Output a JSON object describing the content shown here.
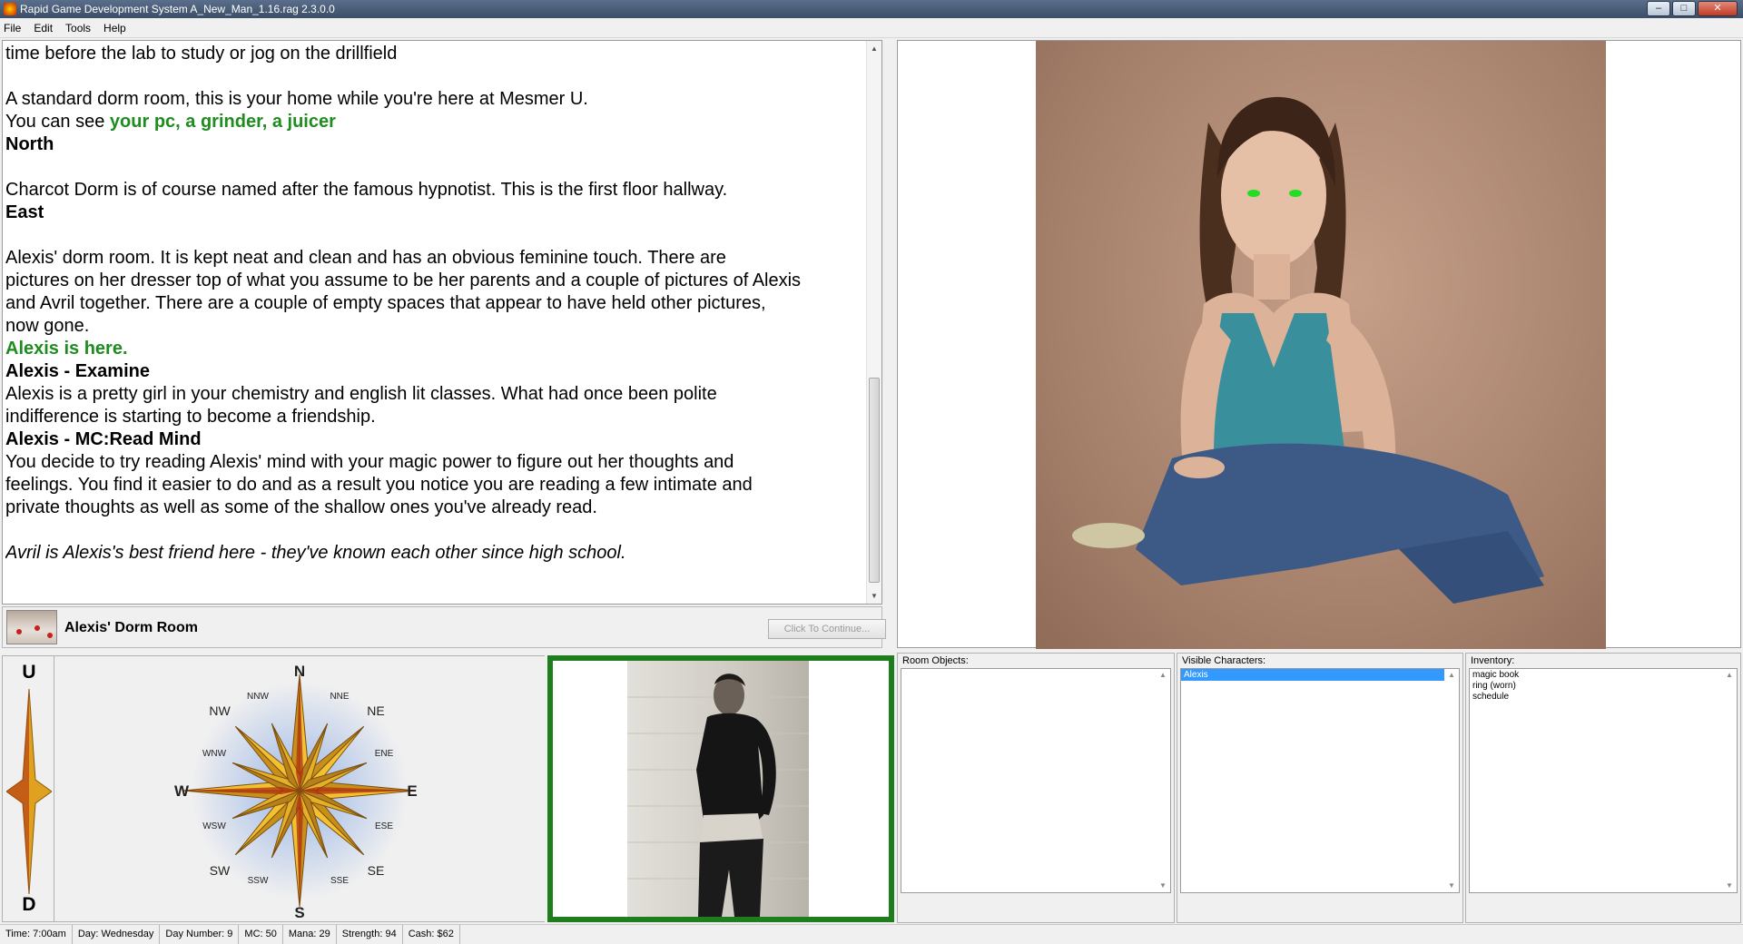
{
  "window": {
    "title": "Rapid Game Development System A_New_Man_1.16.rag 2.3.0.0"
  },
  "menu": [
    "File",
    "Edit",
    "Tools",
    "Help"
  ],
  "story": {
    "lines": [
      {
        "text": "time before the lab to study or jog on the drillfield",
        "style": ""
      },
      {
        "text": "",
        "style": ""
      },
      {
        "text": "A standard dorm room, this is your home while you're here at Mesmer U.",
        "style": ""
      },
      {
        "text": "",
        "style": "see"
      },
      {
        "text": "North",
        "style": "b"
      },
      {
        "text": "",
        "style": ""
      },
      {
        "text": "Charcot Dorm is of course named after the famous hypnotist.   This is the first floor hallway.",
        "style": ""
      },
      {
        "text": "East",
        "style": "b"
      },
      {
        "text": "",
        "style": ""
      },
      {
        "text": "Alexis' dorm room.   It is kept neat and clean and has an obvious feminine touch.  There are",
        "style": ""
      },
      {
        "text": "pictures on her dresser top of what you assume to be her parents and a couple of pictures of Alexis",
        "style": ""
      },
      {
        "text": "and Avril together.   There are a couple of empty spaces that appear to have held other pictures,",
        "style": ""
      },
      {
        "text": "now gone.",
        "style": ""
      },
      {
        "text": "Alexis is here.",
        "style": "g"
      },
      {
        "text": "Alexis - Examine",
        "style": "b"
      },
      {
        "text": "Alexis is a pretty girl in your chemistry and english lit classes.  What had once been polite",
        "style": ""
      },
      {
        "text": "indifference is starting to become a friendship.",
        "style": ""
      },
      {
        "text": "Alexis - MC:Read Mind",
        "style": "b"
      },
      {
        "text": "You decide to try reading Alexis' mind with your magic power to figure out her thoughts and",
        "style": ""
      },
      {
        "text": "feelings.  You find it easier to do and as a result you notice you are reading a few  intimate and",
        "style": ""
      },
      {
        "text": "private thoughts as well as some of the shallow ones you've already read.",
        "style": ""
      },
      {
        "text": "",
        "style": ""
      },
      {
        "text": "Avril is Alexis's best friend here - they've known each other since high school.",
        "style": "i"
      }
    ],
    "see_prefix": "You can see ",
    "see_items": "your pc, a grinder, a juicer"
  },
  "room": {
    "name": "Alexis' Dorm Room",
    "continue_label": "Click To Continue..."
  },
  "updown": {
    "up": "U",
    "down": "D"
  },
  "compass": {
    "N": "N",
    "S": "S",
    "E": "E",
    "W": "W",
    "NE": "NE",
    "NW": "NW",
    "SE": "SE",
    "SW": "SW",
    "NNE": "NNE",
    "NNW": "NNW",
    "ENE": "ENE",
    "ESE": "ESE",
    "SSE": "SSE",
    "SSW": "SSW",
    "WSW": "WSW",
    "WNW": "WNW"
  },
  "room_objects": {
    "title": "Room Objects:",
    "items": []
  },
  "visible_characters": {
    "title": "Visible Characters:",
    "items": [
      "Alexis"
    ],
    "selected": "Alexis"
  },
  "inventory": {
    "title": "Inventory:",
    "items": [
      "magic book",
      "ring (worn)",
      "schedule"
    ]
  },
  "status": {
    "time": "Time:  7:00am",
    "day": "Day: Wednesday",
    "day_number": "Day Number: 9",
    "mc": "MC: 50",
    "mana": "Mana:  29",
    "strength": "Strength:  94",
    "cash": "Cash: $62"
  },
  "colors": {
    "highlight": "#1e8c1e",
    "frame": "#1e7e1e",
    "selection": "#3399ff"
  }
}
